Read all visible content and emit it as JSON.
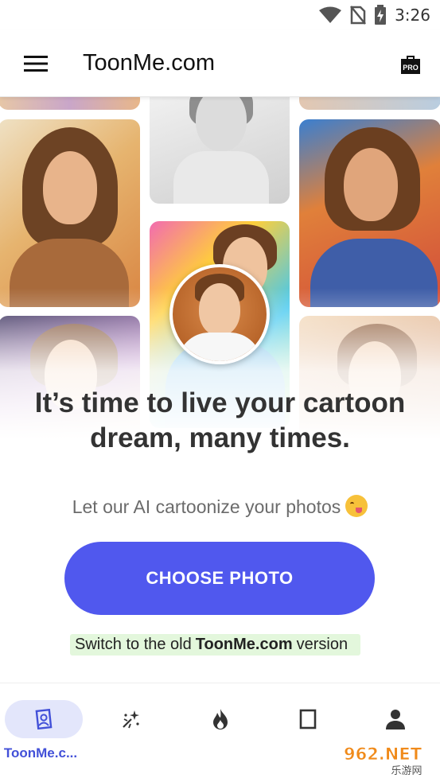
{
  "status_bar": {
    "time": "3:26",
    "icons": [
      "wifi-icon",
      "no-sim-icon",
      "battery-charging-icon"
    ]
  },
  "app_bar": {
    "title": "ToonMe.com",
    "menu_icon": "hamburger-menu-icon",
    "pro_badge": "PRO"
  },
  "hero": {
    "headline_line1": "It’s time to live your cartoon",
    "headline_line2": "dream, many times.",
    "subtitle": "Let our AI cartoonize your photos",
    "subtitle_emoji": "winking-tongue-emoji"
  },
  "actions": {
    "choose_photo": "CHOOSE PHOTO",
    "switch_prefix": "Switch to the old",
    "switch_brand": "ToonMe.com",
    "switch_suffix": "version"
  },
  "bottom_nav": {
    "items": [
      {
        "label": "ToonMe.c...",
        "icon": "toonme-portrait-icon",
        "active": true
      },
      {
        "label": "",
        "icon": "sparkles-icon",
        "active": false
      },
      {
        "label": "",
        "icon": "flame-icon",
        "active": false
      },
      {
        "label": "",
        "icon": "frame-icon",
        "active": false
      },
      {
        "label": "",
        "icon": "profile-icon",
        "active": false
      }
    ]
  },
  "watermark": {
    "text_top": "962.NET",
    "text_bottom": "乐游网"
  },
  "colors": {
    "accent": "#5058ee",
    "nav_active_bg": "#e3e6fb",
    "nav_label": "#4250d8",
    "switch_highlight": "#e3f7dc"
  }
}
